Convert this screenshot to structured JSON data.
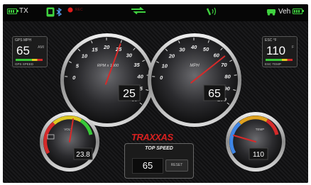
{
  "status_bar": {
    "tx_label": "TX",
    "veh_label": "Veh",
    "record_label": "REC",
    "battery_color": "#3fd13f",
    "icons": [
      "battery-icon",
      "phone-icon",
      "bluetooth-icon",
      "record-icon",
      "swap-arrows-icon",
      "signal-icon",
      "vehicle-icon",
      "battery-icon"
    ]
  },
  "gps_speed_panel": {
    "title": "GPS MPH",
    "value": "65",
    "unit": "AMI",
    "scale_max": "0",
    "footer": "GPS SPEED"
  },
  "esc_temp_panel": {
    "title": "ESC °F",
    "value": "110",
    "unit": "F",
    "scale_max": "0",
    "footer": "ESC TEMP"
  },
  "rpm_gauge": {
    "label": "RPM x 1000",
    "tick_labels": [
      "0",
      "5",
      "10",
      "15",
      "20",
      "25",
      "30",
      "35",
      "40",
      "45",
      "50"
    ],
    "readout": "25",
    "value": 25,
    "max": 50
  },
  "mph_gauge": {
    "label": "MPH",
    "tick_labels": [
      "0",
      "10",
      "20",
      "30",
      "40",
      "50",
      "60",
      "70",
      "80",
      "90",
      "100"
    ],
    "readout": "65",
    "value": 65,
    "max": 100
  },
  "voltage_gauge": {
    "label": "VOLT",
    "readout": "23.8",
    "value": 23.8
  },
  "temp_gauge": {
    "label": "TEMP",
    "readout": "110",
    "value": 110
  },
  "brand_logo": "TRAXXAS",
  "top_speed": {
    "title": "TOP SPEED",
    "value": "65",
    "reset_label": "RESET"
  },
  "colors": {
    "accent_green": "#3fd13f",
    "needle_red": "#d62a2a",
    "logo_red": "#d82020"
  }
}
